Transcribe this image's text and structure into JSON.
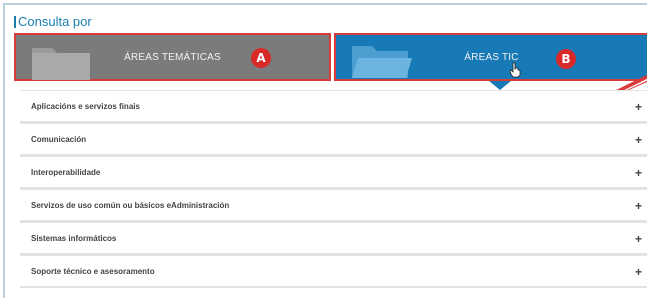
{
  "section": {
    "title": "Consulta por"
  },
  "tabs": [
    {
      "label": "ÁREAS TEMÁTICAS",
      "marker": "A",
      "icon": "folder-closed-icon",
      "color": "#7b7b7b"
    },
    {
      "label": "ÁREAS TIC",
      "marker": "B",
      "icon": "folder-open-icon",
      "color": "#1779b6"
    }
  ],
  "annotation_color": "#d93a3a",
  "items": [
    {
      "label": "Aplicacións e servizos finais",
      "expand": "+"
    },
    {
      "label": "Comunicación",
      "expand": "+"
    },
    {
      "label": "Interoperabilidade",
      "expand": "+"
    },
    {
      "label": "Servizos de uso común ou básicos eAdministración",
      "expand": "+"
    },
    {
      "label": "Sistemas informáticos",
      "expand": "+"
    },
    {
      "label": "Soporte técnico e asesoramento",
      "expand": "+"
    }
  ]
}
